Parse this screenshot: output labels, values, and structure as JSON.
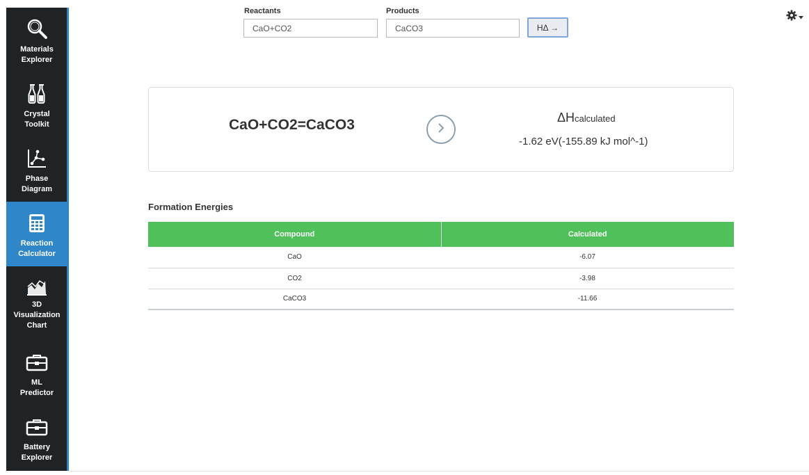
{
  "sidebar": {
    "items": [
      {
        "label": "Materials\nExplorer",
        "icon": "magnifier-icon"
      },
      {
        "label": "Crystal\nToolkit",
        "icon": "flasks-icon"
      },
      {
        "label": "Phase\nDiagram",
        "icon": "phase-diagram-icon"
      },
      {
        "label": "Reaction\nCalculator",
        "icon": "calculator-icon",
        "active": true
      },
      {
        "label": "3D\nVisualization\nChart",
        "icon": "3d-chart-icon"
      },
      {
        "label": "ML\nPredictor",
        "icon": "toolbox-icon"
      },
      {
        "label": "Battery\nExplorer",
        "icon": "toolbox-icon"
      }
    ],
    "accent": "#2f86c8"
  },
  "form": {
    "reactants_label": "Reactants",
    "reactants_value": "CaO+CO2",
    "products_label": "Products",
    "products_value": "CaCO3",
    "submit_label": "HΔ →"
  },
  "result": {
    "equation": "CaO+CO2=CaCO3",
    "dh_symbol": "ΔH",
    "dh_subscript": "calculated",
    "dh_value": "-1.62 eV(-155.89 kJ mol^-1)"
  },
  "formation": {
    "title": "Formation Energies",
    "columns": [
      "Compound",
      "Calculated"
    ],
    "rows": [
      [
        "CaO",
        "-6.07"
      ],
      [
        "CO2",
        "-3.98"
      ],
      [
        "CaCO3",
        "-11.66"
      ]
    ],
    "header_color": "#4fc05a"
  }
}
